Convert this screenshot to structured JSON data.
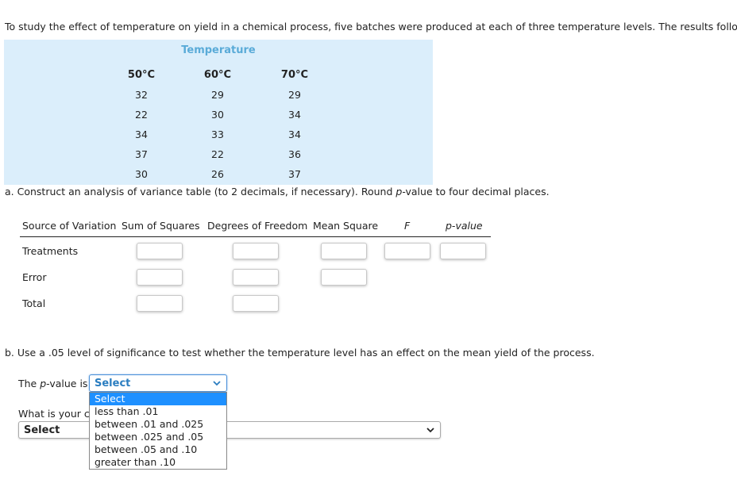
{
  "intro": "To study the effect of temperature on yield in a chemical process, five batches were produced at each of three temperature levels. The results follow.",
  "data_table": {
    "title": "Temperature",
    "columns": [
      "50°C",
      "60°C",
      "70°C"
    ],
    "rows": [
      [
        "32",
        "29",
        "29"
      ],
      [
        "22",
        "30",
        "34"
      ],
      [
        "34",
        "33",
        "34"
      ],
      [
        "37",
        "22",
        "36"
      ],
      [
        "30",
        "26",
        "37"
      ]
    ]
  },
  "part_a": {
    "prompt_pre": "a. Construct an analysis of variance table (to 2 decimals, if necessary). Round ",
    "prompt_p": "p",
    "prompt_post": "-value to four decimal places.",
    "headers": [
      "Source of Variation",
      "Sum of Squares",
      "Degrees of Freedom",
      "Mean Square",
      "F",
      "p-value"
    ],
    "rows": [
      {
        "label": "Treatments",
        "ss": "",
        "df": "",
        "ms": "",
        "f": "",
        "p": ""
      },
      {
        "label": "Error",
        "ss": "",
        "df": "",
        "ms": ""
      },
      {
        "label": "Total",
        "ss": "",
        "df": ""
      }
    ]
  },
  "part_b": {
    "prompt": "b. Use a .05 level of significance to test whether the temperature level has an effect on the mean yield of the process.",
    "pvalue_label_pre": "The ",
    "pvalue_label_p": "p",
    "pvalue_label_post": "-value is",
    "pvalue_selected": "Select",
    "pvalue_options": [
      "Select",
      "less than .01",
      "between .01 and .025",
      "between .025 and .05",
      "between .05 and .10",
      "greater than .10"
    ],
    "conclusion_label": "What is your co",
    "conclusion_selected": "Select"
  },
  "colors": {
    "accent": "#2a7dc0",
    "box_bg": "#dbeefb",
    "title": "#5aabd8",
    "highlight": "#1e90ff"
  }
}
